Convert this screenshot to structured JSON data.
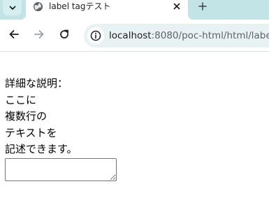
{
  "browser": {
    "tab": {
      "title": "label tagテスト"
    },
    "address_bar": {
      "host": "localhost",
      "path": ":8080/poc-html/html/labelTa"
    },
    "colors": {
      "tabstrip": "#c2e4e7",
      "omnibox": "#e9f2f3",
      "icon": "#3c4043"
    },
    "icons": {
      "tab_search": "chevron-down-icon",
      "favicon": "globe-icon",
      "tab_close": "close-icon",
      "new_tab": "plus-icon",
      "back": "arrow-left-icon",
      "forward": "arrow-right-icon",
      "reload": "reload-icon",
      "site_info": "info-icon"
    }
  },
  "page": {
    "label_lines": [
      "詳細な説明：",
      "ここに",
      "複数行の",
      "テキストを",
      "記述できます。"
    ],
    "textarea_value": ""
  }
}
